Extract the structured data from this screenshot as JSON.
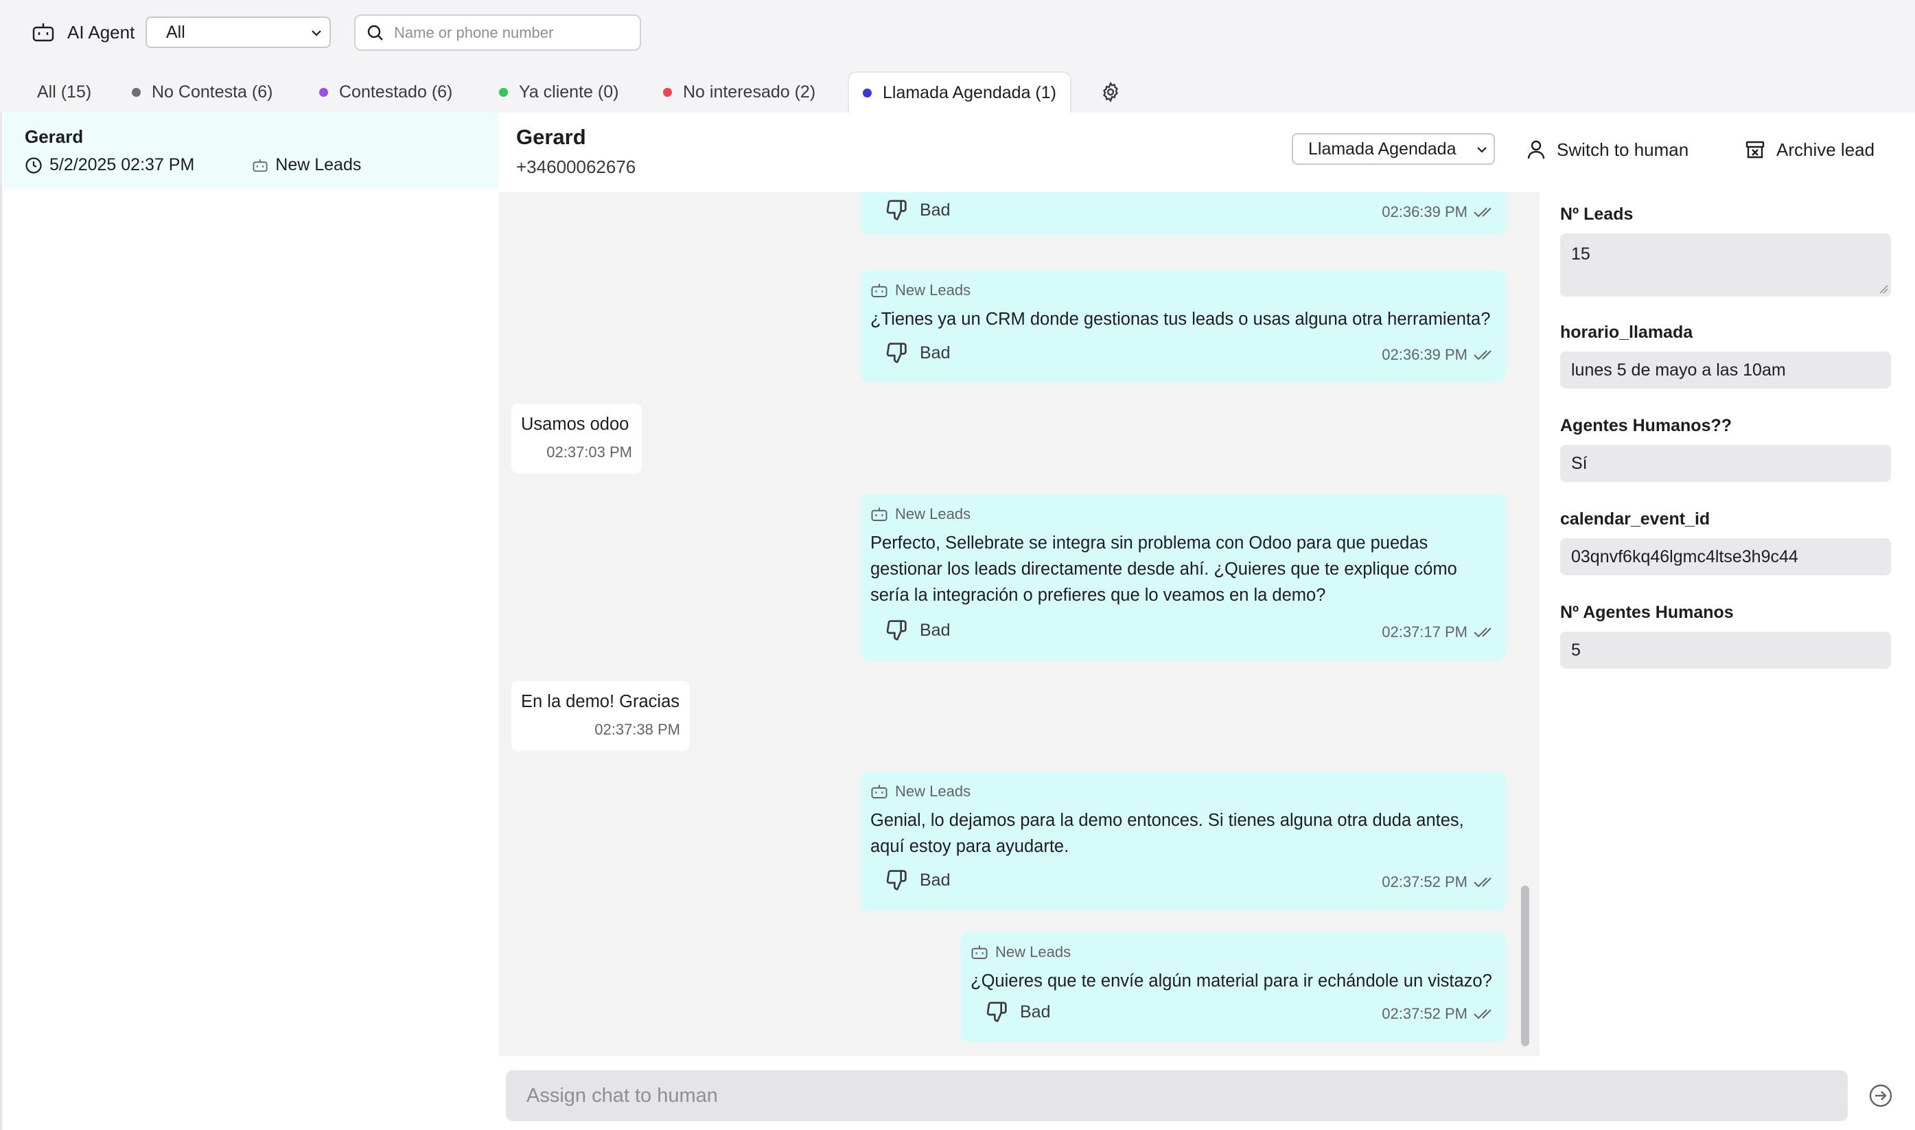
{
  "topbar": {
    "agent_label": "AI Agent",
    "agent_filter_value": "All",
    "search_placeholder": "Name or phone number"
  },
  "tabs": [
    {
      "label": "All (15)",
      "dot_color": ""
    },
    {
      "label": "No Contesta (6)",
      "dot_color": "#6e6e73"
    },
    {
      "label": "Contestado (6)",
      "dot_color": "#9b51e0"
    },
    {
      "label": "Ya cliente (0)",
      "dot_color": "#34c759"
    },
    {
      "label": "No interesado (2)",
      "dot_color": "#e5484d"
    },
    {
      "label": "Llamada Agendada (1)",
      "dot_color": "#3b37d6"
    }
  ],
  "active_tab": 5,
  "lead": {
    "name": "Gerard",
    "date": "5/2/2025 02:37 PM",
    "tag": "New Leads"
  },
  "chat": {
    "contact_name": "Gerard",
    "phone": "+34600062676",
    "status_value": "Llamada Agendada",
    "switch_label": "Switch to human",
    "archive_label": "Archive lead",
    "feedback_label": "Bad",
    "bot_tag": "New Leads",
    "messages": [
      {
        "from": "bot",
        "tag": "",
        "lines": [],
        "time": "02:36:39 PM"
      },
      {
        "from": "bot",
        "tag": "New Leads",
        "lines": [
          "¿Tienes ya un CRM donde gestionas tus leads o usas alguna otra herramienta?"
        ],
        "time": "02:36:39 PM"
      },
      {
        "from": "user",
        "lines": [
          "Usamos odoo"
        ],
        "time": "02:37:03 PM"
      },
      {
        "from": "bot",
        "tag": "New Leads",
        "lines": [
          "Perfecto, Sellebrate se integra sin problema con Odoo para que puedas",
          "gestionar los leads directamente desde ahí. ¿Quieres que te explique cómo",
          "sería la integración o prefieres que lo veamos en la demo?"
        ],
        "time": "02:37:17 PM"
      },
      {
        "from": "user",
        "lines": [
          "En la demo! Gracias"
        ],
        "time": "02:37:38 PM"
      },
      {
        "from": "bot",
        "tag": "New Leads",
        "lines": [
          "Genial, lo dejamos para la demo entonces. Si tienes alguna otra duda antes,",
          "aquí estoy para ayudarte."
        ],
        "time": "02:37:52 PM"
      },
      {
        "from": "bot",
        "tag": "New Leads",
        "lines": [
          "¿Quieres que te envíe algún material para ir echándole un vistazo?"
        ],
        "time": "02:37:52 PM"
      }
    ]
  },
  "fields": [
    {
      "label": "Nº Leads",
      "value": "15"
    },
    {
      "label": "horario_llamada",
      "value": "lunes 5 de mayo a las 10am"
    },
    {
      "label": "Agentes Humanos??",
      "value": "Sí"
    },
    {
      "label": "calendar_event_id",
      "value": "03qnvf6kq46lgmc4ltse3h9c44"
    },
    {
      "label": "Nº Agentes Humanos",
      "value": "5"
    }
  ],
  "composer": {
    "placeholder": "Assign chat to human"
  },
  "icons": {
    "agent": "robot-icon",
    "search": "search-icon",
    "settings": "gear-icon",
    "clock": "clock-icon",
    "switch": "user-icon",
    "archive": "archive-icon",
    "feedback": "thumbs-down-icon",
    "read": "double-check-icon",
    "send": "send-icon"
  }
}
